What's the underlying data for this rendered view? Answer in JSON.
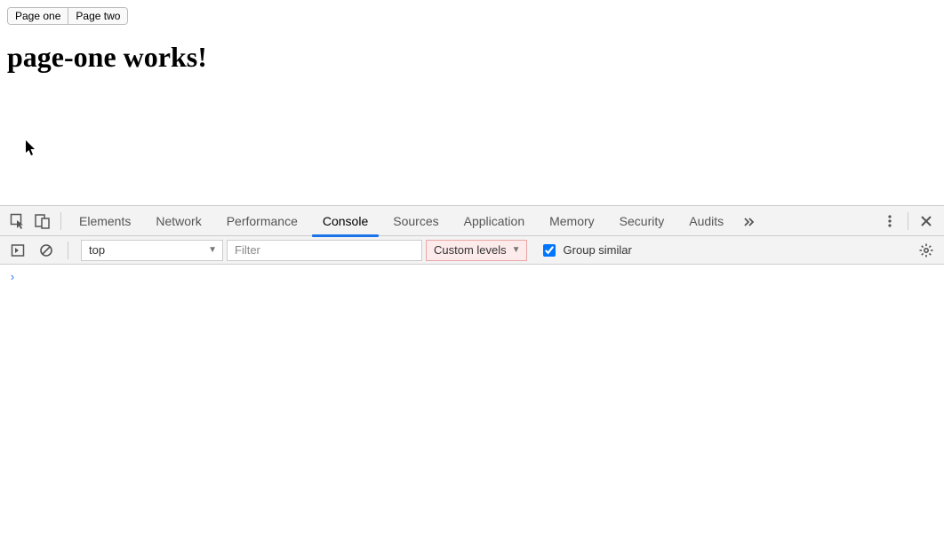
{
  "page": {
    "nav": {
      "btn1": "Page one",
      "btn2": "Page two"
    },
    "heading": "page-one works!"
  },
  "devtools": {
    "tabs": {
      "elements": "Elements",
      "network": "Network",
      "performance": "Performance",
      "console": "Console",
      "sources": "Sources",
      "application": "Application",
      "memory": "Memory",
      "security": "Security",
      "audits": "Audits"
    },
    "toolbar": {
      "context": "top",
      "filter_placeholder": "Filter",
      "levels": "Custom levels",
      "group_similar": "Group similar"
    },
    "console_prompt": ">"
  }
}
